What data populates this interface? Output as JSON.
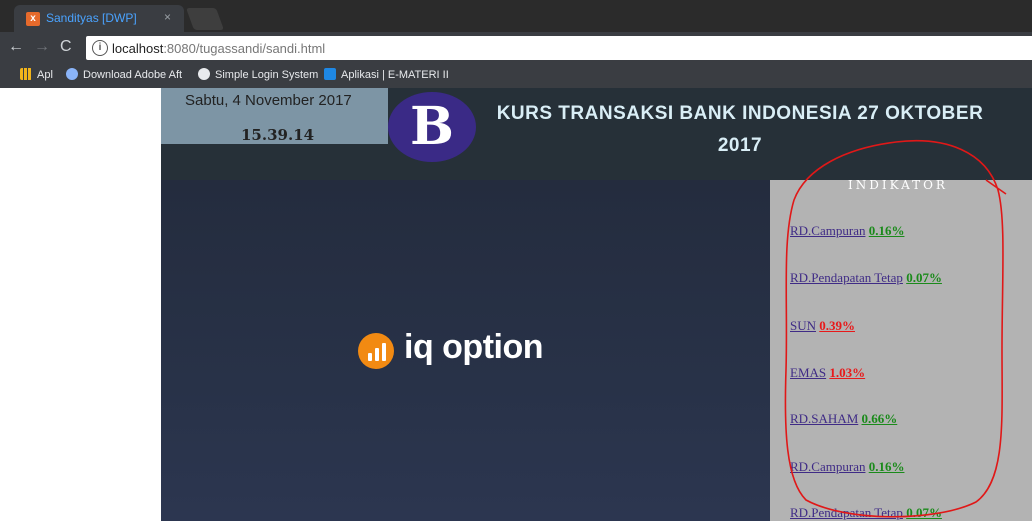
{
  "browser": {
    "tab_title": "Sandityas [DWP]",
    "tab_close": "×",
    "url_host": "localhost",
    "url_rest": ":8080/tugassandi/sandi.html",
    "bookmarks": [
      "Apl",
      "Download Adobe Aft",
      "Simple Login System",
      "Aplikasi | E-MATERI II"
    ]
  },
  "header": {
    "date": "Sabtu, 4 November 2017",
    "time": "15.39.14",
    "logo_text": "B",
    "title_line1": "KURS TRANSAKSI BANK INDONESIA 27 OKTOBER",
    "title_line2": "2017"
  },
  "ad": {
    "brand": "iq option",
    "brand_color": "#f28a12"
  },
  "indicator": {
    "heading": "INDIKATOR",
    "items": [
      {
        "name": "RD.Campuran",
        "value": "0.16%",
        "color": "#1a8a1a"
      },
      {
        "name": "RD.Pendapatan Tetap",
        "value": "0.07%",
        "color": "#1a8a1a"
      },
      {
        "name": "SUN",
        "value": "0.39%",
        "color": "#e8191a"
      },
      {
        "name": "EMAS",
        "value": "1.03%",
        "color": "#e8191a"
      },
      {
        "name": "RD.SAHAM",
        "value": "0.66%",
        "color": "#1a8a1a"
      },
      {
        "name": "RD.Campuran",
        "value": "0.16%",
        "color": "#1a8a1a"
      },
      {
        "name": "RD.Pendapatan Tetap",
        "value": "0.07%",
        "color": "#1a8a1a"
      }
    ]
  }
}
